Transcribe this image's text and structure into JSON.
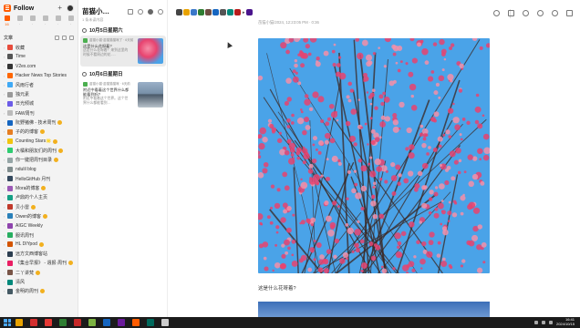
{
  "app": {
    "name": "Follow"
  },
  "sidebar": {
    "view_tabs": [
      {
        "name": "articles",
        "count": "16",
        "active": true,
        "color": "#ff5c00"
      },
      {
        "name": "social",
        "count": "·"
      },
      {
        "name": "pictures",
        "count": "·"
      },
      {
        "name": "videos",
        "count": "·"
      },
      {
        "name": "audio",
        "count": "·"
      },
      {
        "name": "notifications",
        "count": "·"
      }
    ],
    "section_title": "文章",
    "items": [
      {
        "label": "收藏",
        "color": "#e74c3c"
      },
      {
        "label": "Time",
        "color": "#555555"
      },
      {
        "label": "V2ex.com",
        "color": "#333333"
      },
      {
        "label": "Hacker News Top Stories",
        "color": "#ff6600"
      },
      {
        "label": "风雨行者",
        "color": "#3fa9f5"
      },
      {
        "label": "独元素",
        "color": "#999999"
      },
      {
        "label": "日光倾城",
        "color": "#6c5ce7"
      },
      {
        "label": "FAW周刊",
        "color": "#bbbbbb"
      },
      {
        "label": "阮野猪佛 - 技术周刊",
        "color": "#1565c0",
        "badge": true
      },
      {
        "label": "子的的博客",
        "color": "#e67e22",
        "badge": true
      },
      {
        "label": "Counting Stars🌟",
        "color": "#f1c40f",
        "badge": true
      },
      {
        "label": "大橘和朋友们的周刊",
        "color": "#2ecc71",
        "badge": true
      },
      {
        "label": "你一键把周刊目录",
        "color": "#95a5a6",
        "badge": true
      },
      {
        "label": "ndulil blog",
        "color": "#7f8c8d"
      },
      {
        "label": "HelloGitHub 月刊",
        "color": "#34495e"
      },
      {
        "label": "Mora的博客",
        "color": "#9b59b6",
        "badge": true
      },
      {
        "label": "卢鼎的个人主页",
        "color": "#16a085"
      },
      {
        "label": "贝小雷",
        "color": "#c0392b",
        "badge": true
      },
      {
        "label": "Owen的博客",
        "color": "#2980b9",
        "badge": true
      },
      {
        "label": "AIGC Weekly",
        "color": "#8e44ad"
      },
      {
        "label": "服讯周刊",
        "color": "#27ae60"
      },
      {
        "label": "HL DIYpod",
        "color": "#d35400",
        "badge": true
      },
      {
        "label": "远方文西博客站",
        "color": "#2c3e50"
      },
      {
        "label": "《集合早报》 - 週报·周刊",
        "color": "#e91e63",
        "badge": true
      },
      {
        "label": "二丫讲梵",
        "color": "#795548",
        "badge": true
      },
      {
        "label": "清风",
        "color": "#00897b"
      },
      {
        "label": "金明的周刊",
        "color": "#455a64",
        "badge": true
      }
    ]
  },
  "entry_list": {
    "title": "苗猫小…",
    "subtitle": "1 条未读内容",
    "groups": [
      {
        "date": "10月5日星期六",
        "entry": {
          "meta": "苗猫小猫·苗猫猫猫咪了 · 6天前",
          "title": "这是什么花呀着?",
          "desc": "这是什么花呀着？来到这里的时候不看周边的花.....",
          "selected": true
        }
      },
      {
        "date": "10月6日星期日",
        "entry": {
          "meta": "苗猫小猫·苗猫猫猫咪 · 6天前",
          "title": "附近中看着这个世界什么都能看到吗?",
          "desc": "附近中看着这个世界。这个世界什么都能看到...",
          "selected": false
        }
      }
    ]
  },
  "detail": {
    "author_line": "苗猫小猫/2024, 12:23:05 PM · 0:36",
    "caption": "这是什么花呀着?",
    "strip_colors": [
      "#444444",
      "#e8a200",
      "#3a78c9",
      "#2e7d32",
      "#6d4c41",
      "#1565c0",
      "#555555",
      "#00897b",
      "#b71c1c",
      "#4a148c"
    ],
    "photo_colors": {
      "sky": "#4aa3e8",
      "blossom": "#e8436f",
      "blossom_light": "#f58fa8",
      "branch": "#3b2620"
    }
  },
  "taskbar": {
    "apps": [
      "#e8a200",
      "#d32f2f",
      "#e53935",
      "#2e7d32",
      "#c62828",
      "#7cb342",
      "#1565c0",
      "#6a1b9a",
      "#ff5c00",
      "#00695c",
      "#cccccc"
    ],
    "time": "16:41",
    "date": "2024/10/15"
  }
}
